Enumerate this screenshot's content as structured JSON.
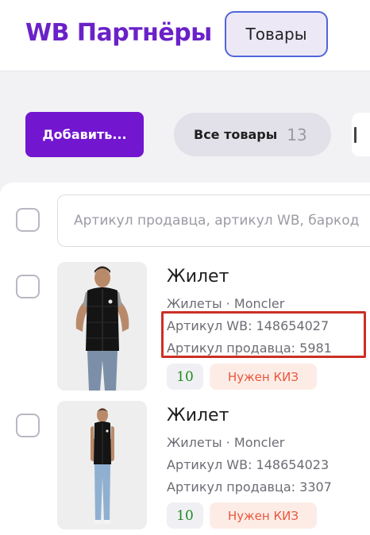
{
  "header": {
    "brand": "WB Партнёры",
    "nav_button": "Товары"
  },
  "toolbar": {
    "add_button": "Добавить...",
    "filter_all_label": "Все товары",
    "filter_all_count": "13"
  },
  "search": {
    "placeholder": "Артикул продавца, артикул WB, баркод"
  },
  "products": [
    {
      "title": "Жилет",
      "category": "Жилеты · Moncler",
      "wb_article": "Артикул WB: 148654027",
      "seller_article": "Артикул продавца: 5981",
      "stock": "10",
      "kiz_badge": "Нужен КИЗ"
    },
    {
      "title": "Жилет",
      "category": "Жилеты · Moncler",
      "wb_article": "Артикул WB: 148654023",
      "seller_article": "Артикул продавца: 3307",
      "stock": "10",
      "kiz_badge": "Нужен КИЗ"
    }
  ],
  "colors": {
    "brand": "#6b21c8",
    "accent_button": "#7216cf",
    "highlight_frame": "#cc2f25",
    "stock_green": "#1f8a1f",
    "kiz_orange": "#e8573d"
  },
  "icons": [
    "checkbox-icon",
    "product-photo"
  ]
}
